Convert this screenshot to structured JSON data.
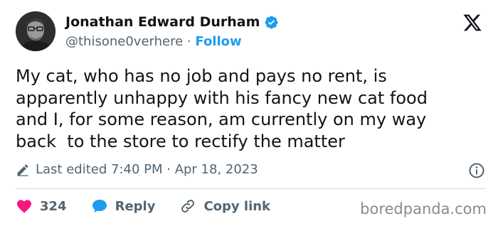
{
  "author": {
    "name": "Jonathan Edward Durham",
    "handle": "@thisone0verhere",
    "separator": "·",
    "follow_label": "Follow"
  },
  "tweet": {
    "text": "My cat, who has no job and pays no rent, is\napparently unhappy with his fancy new cat food\nand I, for some reason, am currently on my way\nback  to the store to rectify the matter",
    "edited_label": "Last edited 7:40 PM · Apr 18, 2023"
  },
  "actions": {
    "like_count": "324",
    "reply_label": "Reply",
    "copy_link_label": "Copy link"
  },
  "watermark": "boredpanda.com",
  "colors": {
    "accent": "#1d9bf0",
    "like": "#f91880",
    "text": "#0f1419",
    "secondary": "#536471"
  },
  "icons": [
    "verified-badge-icon",
    "x-logo-icon",
    "pencil-icon",
    "info-icon",
    "heart-icon",
    "reply-bubble-icon",
    "link-icon"
  ]
}
